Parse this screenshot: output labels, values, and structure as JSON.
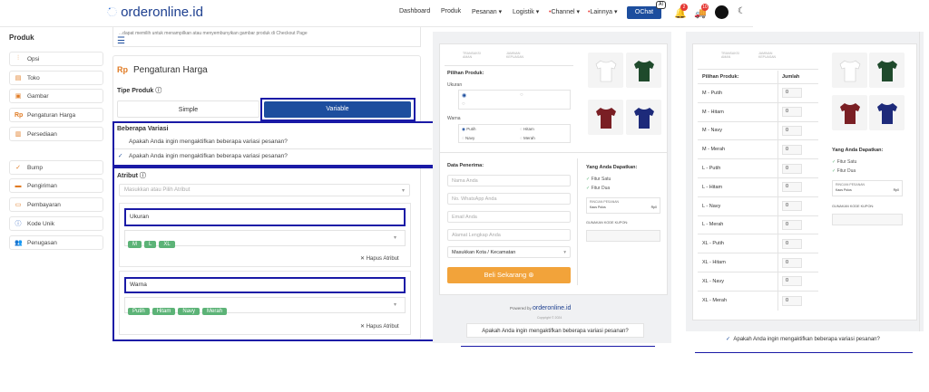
{
  "brand": "orderonline.id",
  "nav": {
    "dashboard": "Dashboard",
    "produk": "Produk",
    "pesanan": "Pesanan",
    "logistik": "Logistik",
    "channel": "Channel",
    "lainnya": "Lainnya",
    "chevron": "▾",
    "ochat": "OChat",
    "ai": "AI",
    "bell_count": "2",
    "truck_count": "10"
  },
  "sidebar": {
    "title": "Produk",
    "items": [
      {
        "label": "Opsi",
        "icon": "sliders-icon"
      },
      {
        "label": "Toko",
        "icon": "store-icon"
      },
      {
        "label": "Gambar",
        "icon": "image-icon"
      },
      {
        "label": "Pengaturan Harga",
        "icon": "rp-icon"
      },
      {
        "label": "Persediaan",
        "icon": "box-icon"
      },
      {
        "label": "Bump",
        "icon": "check-icon"
      },
      {
        "label": "Pengiriman",
        "icon": "truck-icon"
      },
      {
        "label": "Pembayaran",
        "icon": "card-icon"
      },
      {
        "label": "Kode Unik",
        "icon": "info-icon"
      },
      {
        "label": "Penugasan",
        "icon": "users-icon"
      }
    ]
  },
  "panel": {
    "image_hint": "...dapat memilih untuk menampilkan atau menyembunyikan gambar produk di Checkout Page",
    "title_rp": "Rp",
    "title": "Pengaturan Harga",
    "tipe_produk": "Tipe Produk",
    "simple": "Simple",
    "variable": "Variable",
    "beberapa_variasi": "Beberapa Variasi",
    "variasi_q1": "Apakah Anda ingin mengaktifkan beberapa variasi pesanan?",
    "variasi_q2": "Apakah Anda ingin mengaktifkan beberapa variasi pesanan?",
    "atribut": "Atribut",
    "atribut_placeholder": "Masukkan atau Pilih Atribut",
    "attr1_name": "Ukuran",
    "attr1_tags": [
      "M",
      "L",
      "XL"
    ],
    "attr2_name": "Warna",
    "attr2_tags": [
      "Putih",
      "Hitam",
      "Navy",
      "Merah"
    ],
    "hapus": "Hapus Atribut"
  },
  "preview1": {
    "badge1": "TRANSAKSI AMAN",
    "badge2": "JAMINAN KEPUASAN",
    "pilihan_produk": "Pilihan Produk:",
    "ukuran": "Ukuran",
    "warna": "Warna",
    "warna_opts": [
      "Putih",
      "Hitam",
      "Navy",
      "Merah"
    ],
    "data_penerima": "Data Penerima:",
    "fields": [
      "Nama Anda",
      "No. WhatsApp Anda",
      "Email Anda",
      "Alamat Lengkap Anda"
    ],
    "kota": "Masukkan Kota / Kecamatan",
    "yang_anda": "Yang Anda Dapatkan:",
    "fitur": [
      "Fitur Satu",
      "Fitur Dua"
    ],
    "rincian": "RINCIAN PESANAN",
    "rincian_row": "Kaos Polos",
    "rincian_price": "Rp0",
    "kupon": "GUNAKAN KODE KUPON:",
    "beli": "Beli Sekarang",
    "powered": "Powered by",
    "copyright": "Copyright © 2024",
    "question": "Apakah Anda ingin mengaktifkan beberapa variasi pesanan?"
  },
  "preview2": {
    "col1": "Pilihan Produk:",
    "col2": "Jumlah",
    "rows": [
      "M - Putih",
      "M - Hitam",
      "M - Navy",
      "M - Merah",
      "L - Putih",
      "L - Hitam",
      "L - Navy",
      "L - Merah",
      "XL - Putih",
      "XL - Hitam",
      "XL - Navy",
      "XL - Merah"
    ],
    "qty": "0",
    "yang_anda": "Yang Anda Dapatkan:",
    "fitur": [
      "Fitur Satu",
      "Fitur Dua"
    ],
    "rincian": "RINCIAN PESANAN",
    "rincian_row": "Kaos Polos",
    "rincian_price": "Rp0",
    "kupon": "GUNAKAN KODE KUPON:",
    "question": "Apakah Anda ingin mengaktifkan beberapa variasi pesanan?"
  },
  "colors": {
    "primary": "#1d4e9e",
    "accent": "#f2a33a",
    "highlight": "#1a1aa6",
    "tag": "#5cb377",
    "shirt_white": "#f4f4f4",
    "shirt_green": "#1f4a2c",
    "shirt_red": "#7a1f24",
    "shirt_navy": "#1d2a7a"
  }
}
